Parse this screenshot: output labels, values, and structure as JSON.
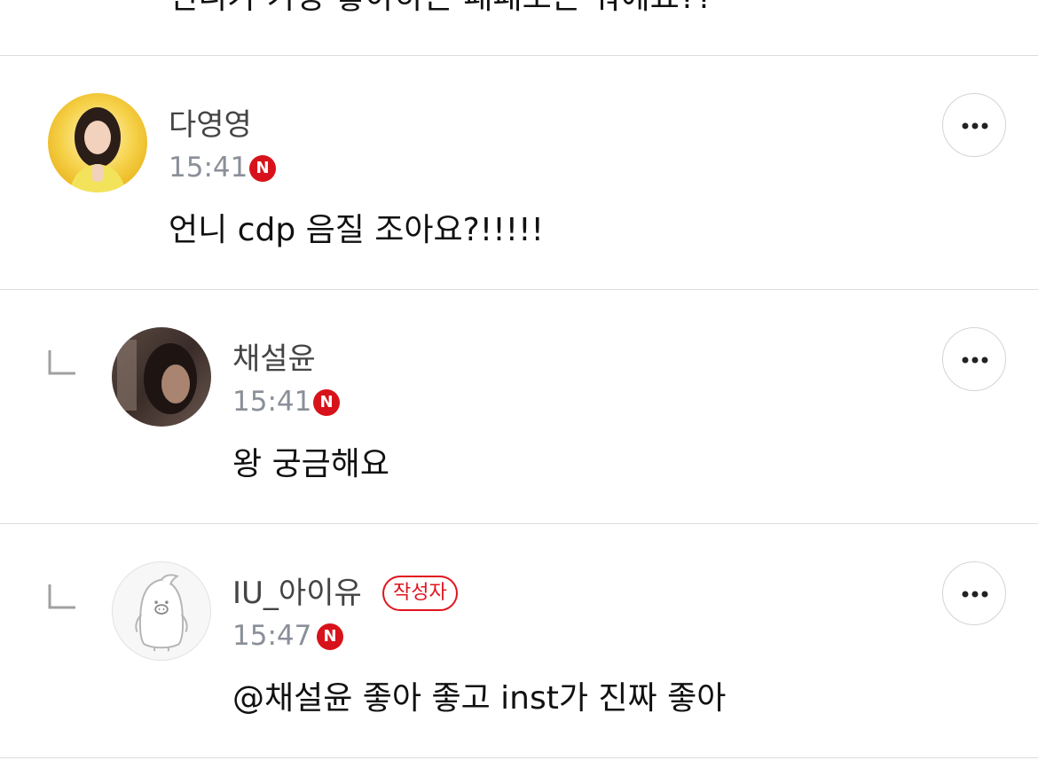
{
  "previous_comment": {
    "text": "언니가 가장 좋아하는 패패오는 뭐예요??"
  },
  "comments": [
    {
      "author": "다영영",
      "time": "15:41",
      "new_badge": "N",
      "text": "언니 cdp 음질 조아요?!!!!!",
      "is_reply": false,
      "avatar_icon": "user-photo-avatar"
    },
    {
      "author": "채설윤",
      "time": "15:41",
      "new_badge": "N",
      "text": "왕 궁금해요",
      "is_reply": true,
      "avatar_icon": "user-photo-avatar"
    },
    {
      "author": "IU_아이유",
      "author_badge": "작성자",
      "time": "15:47",
      "new_badge": "N",
      "text": "@채설윤  좋아 좋고 inst가 진짜 좋아",
      "is_reply": true,
      "avatar_icon": "default-penguin-avatar"
    }
  ],
  "colors": {
    "accent_red": "#d8121a",
    "meta_gray": "#8a8f98",
    "divider": "#dcdcdc"
  }
}
